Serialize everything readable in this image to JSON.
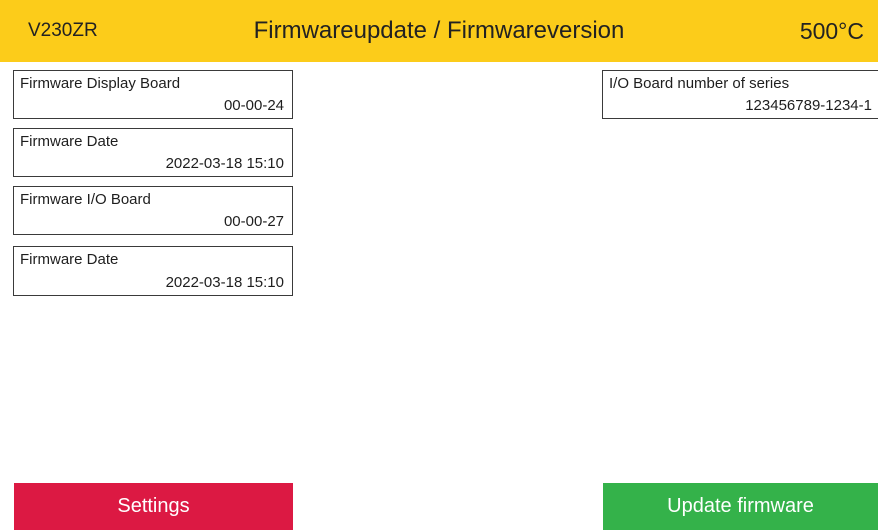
{
  "header": {
    "model": "V230ZR",
    "title": "Firmwareupdate / Firmwareversion",
    "temperature": "500°C"
  },
  "fields": {
    "display_board": {
      "label": "Firmware Display Board",
      "value": "00-00-24"
    },
    "display_date": {
      "label": "Firmware Date",
      "value": "2022-03-18  15:10"
    },
    "io_board": {
      "label": "Firmware I/O Board",
      "value": "00-00-27"
    },
    "io_date": {
      "label": "Firmware Date",
      "value": "2022-03-18  15:10"
    },
    "io_serial": {
      "label": "I/O Board number of series",
      "value": "123456789-1234-1"
    }
  },
  "buttons": {
    "settings": "Settings",
    "update": "Update firmware"
  },
  "colors": {
    "header_bg": "#fccc1a",
    "settings_bg": "#dc1943",
    "update_bg": "#34b24a"
  }
}
